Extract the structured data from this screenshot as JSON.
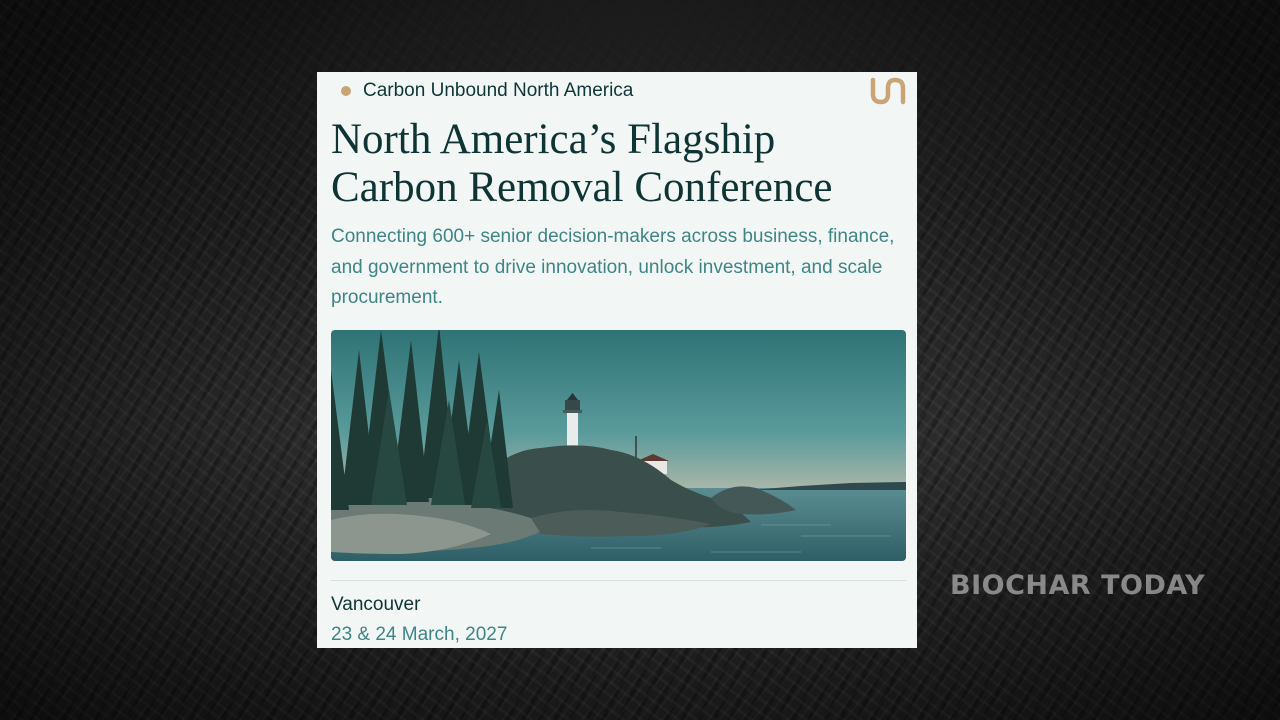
{
  "card": {
    "eyebrow": "Carbon Unbound North America",
    "headline_line1": "North America’s Flagship",
    "headline_line2": "Carbon Removal Conference",
    "description": "Connecting 600+ senior decision-makers across business, finance, and government to drive innovation, unlock investment, and scale procurement.",
    "location": "Vancouver",
    "dates": "23 & 24 March, 2027",
    "logo_icon": "carbon-unbound-logo",
    "hero_image": "lighthouse-coastline-photo"
  },
  "watermark": {
    "text": "BIOCHAR TODAY"
  },
  "colors": {
    "accent_gold": "#c9a474",
    "headline": "#0f3434",
    "teal_text": "#3f8585",
    "card_bg": "#f2f7f6"
  }
}
